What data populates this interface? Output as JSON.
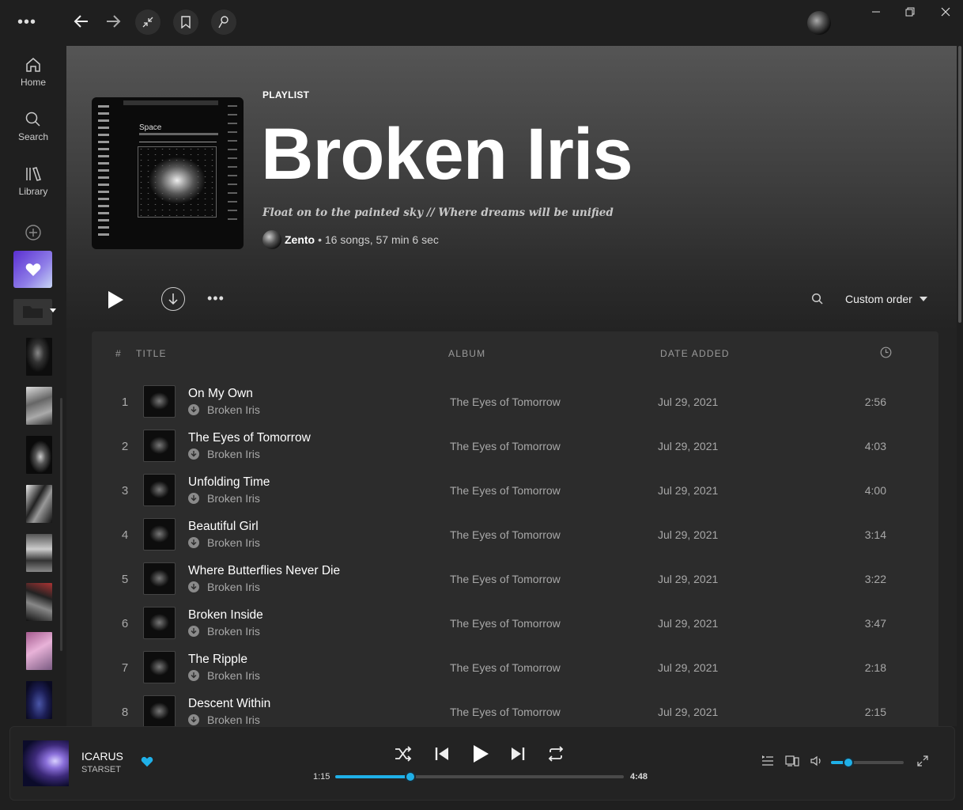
{
  "sidebar": {
    "items": [
      {
        "label": "Home",
        "icon": "home-icon"
      },
      {
        "label": "Search",
        "icon": "search-icon"
      },
      {
        "label": "Library",
        "icon": "library-icon"
      }
    ]
  },
  "playlist": {
    "type": "PLAYLIST",
    "title": "Broken Iris",
    "description": "Float on to the painted sky // Where dreams will be unified",
    "owner": "Zento",
    "meta": "• 16 songs, 57 min 6 sec",
    "sort_label": "Custom order"
  },
  "table": {
    "headers": {
      "num": "#",
      "title": "TITLE",
      "album": "ALBUM",
      "date": "DATE ADDED"
    },
    "rows": [
      {
        "num": "1",
        "name": "On My Own",
        "artist": "Broken Iris",
        "album": "The Eyes of Tomorrow",
        "date": "Jul 29, 2021",
        "duration": "2:56"
      },
      {
        "num": "2",
        "name": "The Eyes of Tomorrow",
        "artist": "Broken Iris",
        "album": "The Eyes of Tomorrow",
        "date": "Jul 29, 2021",
        "duration": "4:03"
      },
      {
        "num": "3",
        "name": "Unfolding Time",
        "artist": "Broken Iris",
        "album": "The Eyes of Tomorrow",
        "date": "Jul 29, 2021",
        "duration": "4:00"
      },
      {
        "num": "4",
        "name": "Beautiful Girl",
        "artist": "Broken Iris",
        "album": "The Eyes of Tomorrow",
        "date": "Jul 29, 2021",
        "duration": "3:14"
      },
      {
        "num": "5",
        "name": "Where Butterflies Never Die",
        "artist": "Broken Iris",
        "album": "The Eyes of Tomorrow",
        "date": "Jul 29, 2021",
        "duration": "3:22"
      },
      {
        "num": "6",
        "name": "Broken Inside",
        "artist": "Broken Iris",
        "album": "The Eyes of Tomorrow",
        "date": "Jul 29, 2021",
        "duration": "3:47"
      },
      {
        "num": "7",
        "name": "The Ripple",
        "artist": "Broken Iris",
        "album": "The Eyes of Tomorrow",
        "date": "Jul 29, 2021",
        "duration": "2:18"
      },
      {
        "num": "8",
        "name": "Descent Within",
        "artist": "Broken Iris",
        "album": "The Eyes of Tomorrow",
        "date": "Jul 29, 2021",
        "duration": "2:15"
      }
    ]
  },
  "cover_text": {
    "title": "Space"
  },
  "player": {
    "track": "ICARUS",
    "artist": "STARSET",
    "elapsed": "1:15",
    "total": "4:48",
    "progress": 0.26,
    "volume": 0.24
  },
  "colors": {
    "accent": "#1fb0e8",
    "background": "#1f1f1f"
  }
}
